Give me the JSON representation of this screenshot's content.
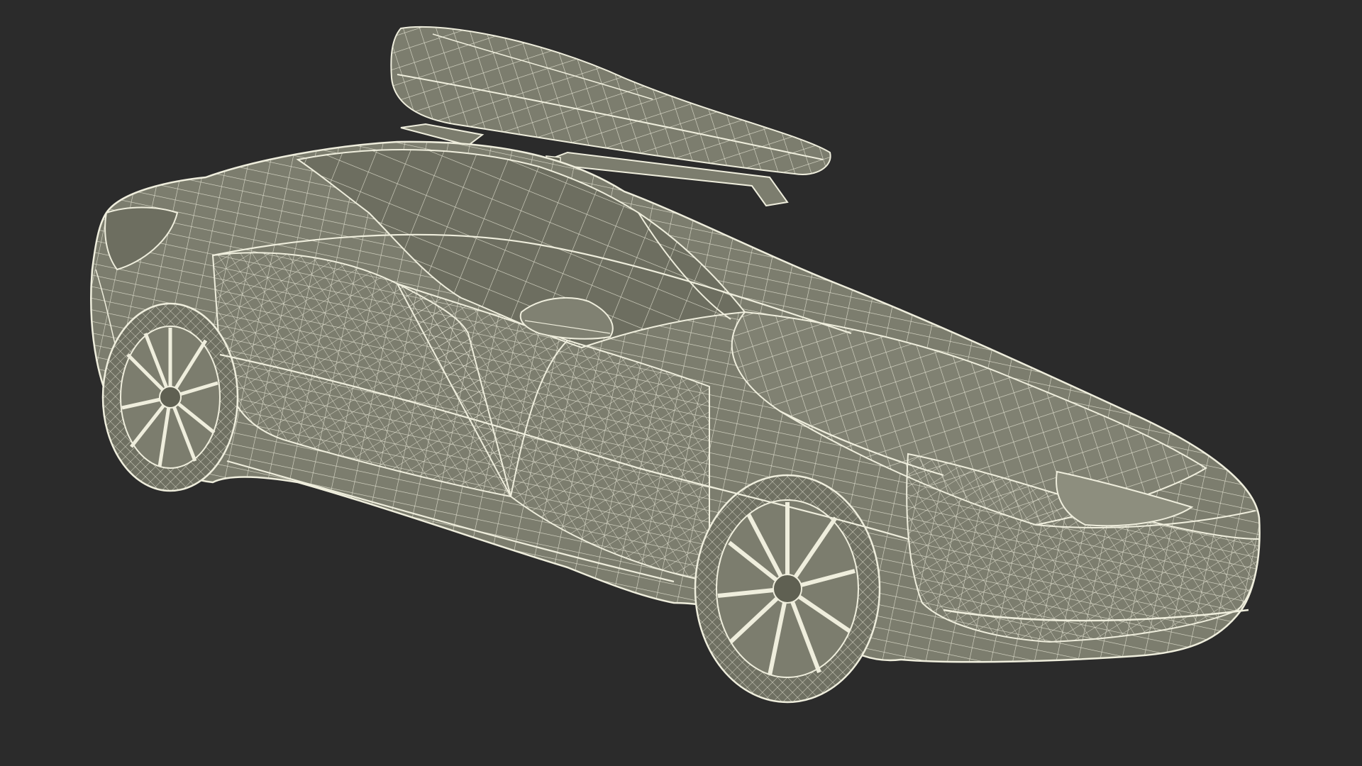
{
  "viewport": {
    "subject": "wireframe-car-with-roof-box",
    "background_color": "#2b2b2b",
    "shade_color": "#7c7d6e",
    "shade_dark_color": "#5f6052",
    "shade_light_color": "#8d8e7e",
    "wire_color": "#efeedd",
    "tire_color": "#6f7062"
  }
}
